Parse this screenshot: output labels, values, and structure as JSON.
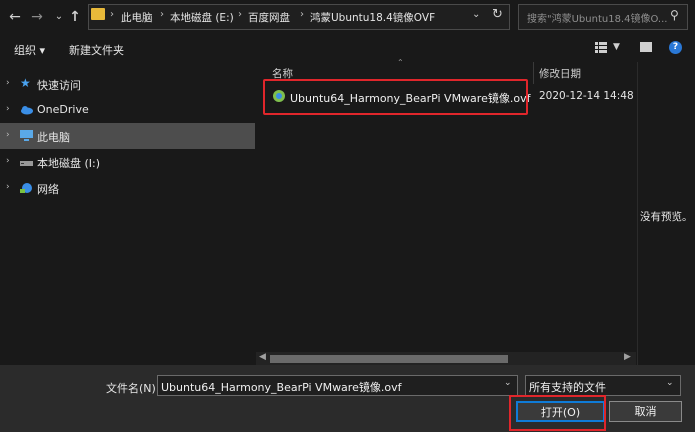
{
  "nav": {
    "back": "←",
    "forward": "→",
    "recent": "⌄",
    "up": "↑"
  },
  "breadcrumb": [
    "此电脑",
    "本地磁盘 (E:)",
    "百度网盘",
    "鸿蒙Ubuntu18.4镜像OVF"
  ],
  "search": {
    "placeholder": "搜索\"鸿蒙Ubuntu18.4镜像O..."
  },
  "toolbar": {
    "organize": "组织 ▾",
    "new_folder": "新建文件夹"
  },
  "sidebar": {
    "items": [
      {
        "label": "快速访问",
        "icon": "star-icon"
      },
      {
        "label": "OneDrive",
        "icon": "cloud-icon"
      },
      {
        "label": "此电脑",
        "icon": "computer-icon",
        "selected": true
      },
      {
        "label": "本地磁盘 (I:)",
        "icon": "drive-icon"
      },
      {
        "label": "网络",
        "icon": "network-icon"
      }
    ]
  },
  "columns": {
    "name": "名称",
    "date": "修改日期"
  },
  "files": [
    {
      "name": "Ubuntu64_Harmony_BearPi VMware镜像.ovf",
      "date": "2020-12-14 14:48",
      "icon": "vmware-file-icon"
    }
  ],
  "preview": {
    "text": "没有预览。"
  },
  "footer": {
    "filename_label": "文件名(N):",
    "filename_value": "Ubuntu64_Harmony_BearPi VMware镜像.ovf",
    "filetype_value": "所有支持的文件",
    "open_label": "打开(O)",
    "cancel_label": "取消"
  },
  "colors": {
    "accent": "#0f7bd7",
    "highlight": "#e0262b",
    "selected_bg": "#4d4d4d",
    "background": "#191919"
  }
}
